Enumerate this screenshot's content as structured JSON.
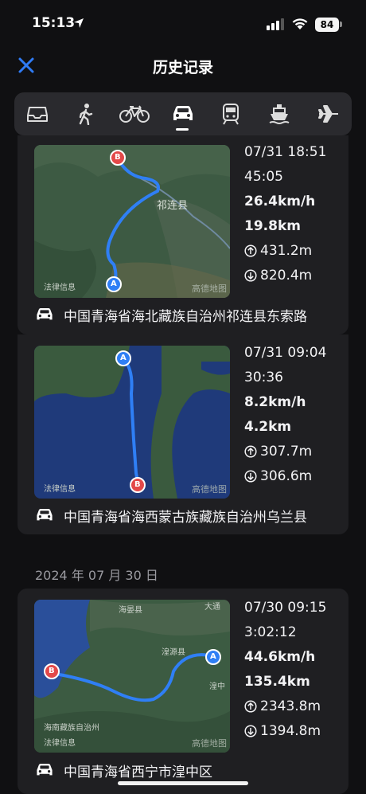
{
  "status_bar": {
    "time": "15:13",
    "battery": "84"
  },
  "nav": {
    "title": "历史记录",
    "accent_color": "#2f7bf5"
  },
  "tabs": [
    {
      "icon": "inbox-tray-icon",
      "active": false
    },
    {
      "icon": "walking-icon",
      "active": false
    },
    {
      "icon": "bicycle-icon",
      "active": false
    },
    {
      "icon": "car-icon",
      "active": true
    },
    {
      "icon": "train-icon",
      "active": false
    },
    {
      "icon": "ship-icon",
      "active": false
    },
    {
      "icon": "airplane-icon",
      "active": false
    }
  ],
  "trips": [
    {
      "datetime": "07/31 18:51",
      "duration": "45:05",
      "speed": "26.4km/h",
      "distance": "19.8km",
      "ascent": "431.2m",
      "descent": "820.4m",
      "address": "中国青海省海北藏族自治州祁连县东索路",
      "map": {
        "place_label": "祁连县",
        "legal_label": "法律信息",
        "logo": "高德地图",
        "start": "A",
        "end": "B"
      }
    },
    {
      "datetime": "07/31 09:04",
      "duration": "30:36",
      "speed": "8.2km/h",
      "distance": "4.2km",
      "ascent": "307.7m",
      "descent": "306.6m",
      "address": "中国青海省海西蒙古族藏族自治州乌兰县",
      "map": {
        "legal_label": "法律信息",
        "logo": "高德地图",
        "start": "A",
        "end": "B"
      }
    },
    {
      "datetime": "07/30 09:15",
      "duration": "3:02:12",
      "speed": "44.6km/h",
      "distance": "135.4km",
      "ascent": "2343.8m",
      "descent": "1394.8m",
      "address": "中国青海省西宁市湟中区",
      "map": {
        "labels": [
          "海晏县",
          "湟源县",
          "海南藏族自治州",
          "湟中"
        ],
        "legal_label": "法律信息",
        "logo": "高德地图",
        "start": "A",
        "end": "B",
        "top_right_label": "大通"
      }
    }
  ],
  "date_header": "2024 年 07 月 30 日"
}
